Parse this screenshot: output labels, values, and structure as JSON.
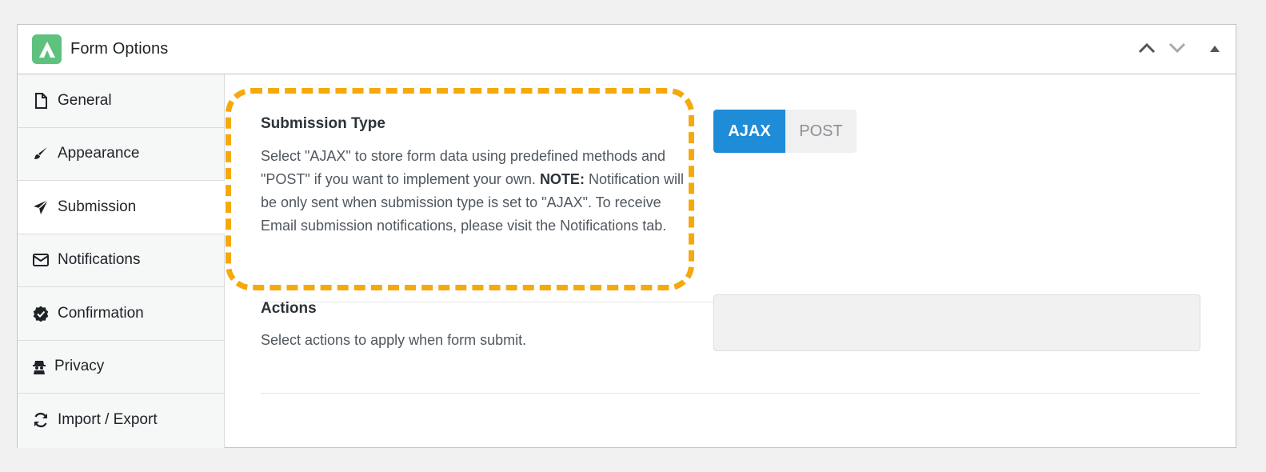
{
  "panel": {
    "title": "Form Options",
    "logo": "logo-icon",
    "controls": {
      "move_up": "chevron-up-icon",
      "move_down": "chevron-down-icon",
      "toggle": "triangle-up-icon"
    }
  },
  "sidebar": {
    "items": [
      {
        "label": "General",
        "icon": "file-icon",
        "active": false
      },
      {
        "label": "Appearance",
        "icon": "paintbrush-icon",
        "active": false
      },
      {
        "label": "Submission",
        "icon": "paper-plane-icon",
        "active": true
      },
      {
        "label": "Notifications",
        "icon": "envelope-icon",
        "active": false
      },
      {
        "label": "Confirmation",
        "icon": "check-badge-icon",
        "active": false
      },
      {
        "label": "Privacy",
        "icon": "user-secret-icon",
        "active": false
      },
      {
        "label": "Import / Export",
        "icon": "refresh-icon",
        "active": false
      }
    ]
  },
  "submission_type": {
    "title": "Submission Type",
    "description_part1": "Select \"AJAX\" to store form data using predefined methods and \"POST\" if you want to implement your own.",
    "note_label": "NOTE:",
    "description_part2": "Notification will be only sent when submission type is set to \"AJAX\". To receive Email submission notifications, please visit the Notifications tab.",
    "options": [
      "AJAX",
      "POST"
    ],
    "selected": "AJAX"
  },
  "actions": {
    "title": "Actions",
    "description": "Select actions to apply when form submit.",
    "value": ""
  },
  "colors": {
    "accent": "#1e8cd6",
    "highlight": "#f5a90c",
    "logo": "#5ec27e"
  }
}
